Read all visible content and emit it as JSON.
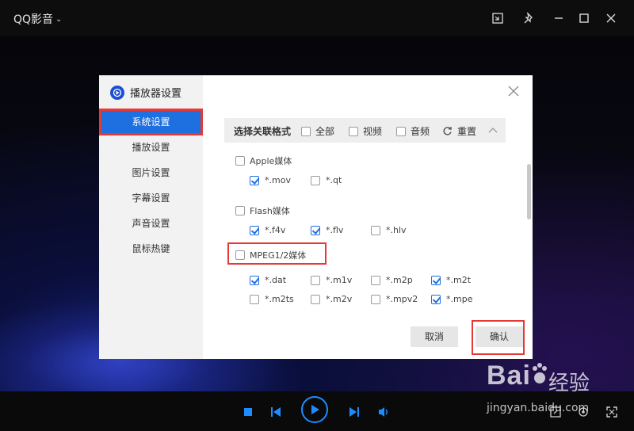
{
  "app": {
    "title": "QQ影音"
  },
  "titlebar_icons": [
    "mini-mode-icon",
    "pin-icon",
    "minimize-icon",
    "maximize-icon",
    "close-icon"
  ],
  "dialog": {
    "title": "播放器设置",
    "sidebar": [
      {
        "label": "系统设置",
        "active": true
      },
      {
        "label": "播放设置",
        "active": false
      },
      {
        "label": "图片设置",
        "active": false
      },
      {
        "label": "字幕设置",
        "active": false
      },
      {
        "label": "声音设置",
        "active": false
      },
      {
        "label": "鼠标热键",
        "active": false
      }
    ],
    "assoc": {
      "title": "选择关联格式",
      "all": "全部",
      "video": "视频",
      "audio": "音频",
      "reset": "重置"
    },
    "groups": {
      "apple": {
        "label": "Apple媒体",
        "checked": false
      },
      "flash": {
        "label": "Flash媒体",
        "checked": false
      },
      "mpeg": {
        "label": "MPEG1/2媒体",
        "checked": false
      }
    },
    "formats": {
      "mov": {
        "label": "*.mov",
        "checked": true
      },
      "qt": {
        "label": "*.qt",
        "checked": false
      },
      "f4v": {
        "label": "*.f4v",
        "checked": true
      },
      "flv": {
        "label": "*.flv",
        "checked": true
      },
      "hlv": {
        "label": "*.hlv",
        "checked": false
      },
      "dat": {
        "label": "*.dat",
        "checked": true
      },
      "m1v": {
        "label": "*.m1v",
        "checked": false
      },
      "m2p": {
        "label": "*.m2p",
        "checked": false
      },
      "m2t": {
        "label": "*.m2t",
        "checked": true
      },
      "m2ts": {
        "label": "*.m2ts",
        "checked": false
      },
      "m2v": {
        "label": "*.m2v",
        "checked": false
      },
      "mpv2": {
        "label": "*.mpv2",
        "checked": false
      },
      "mpe": {
        "label": "*.mpe",
        "checked": true
      }
    },
    "buttons": {
      "cancel": "取消",
      "ok": "确认"
    }
  },
  "watermark": {
    "brand": "Bai",
    "brand_cn": "经验",
    "url": "jingyan.baidu.com"
  },
  "colors": {
    "accent": "#1e6fe0",
    "player_blue": "#1e8cff",
    "highlight": "#e53935"
  }
}
